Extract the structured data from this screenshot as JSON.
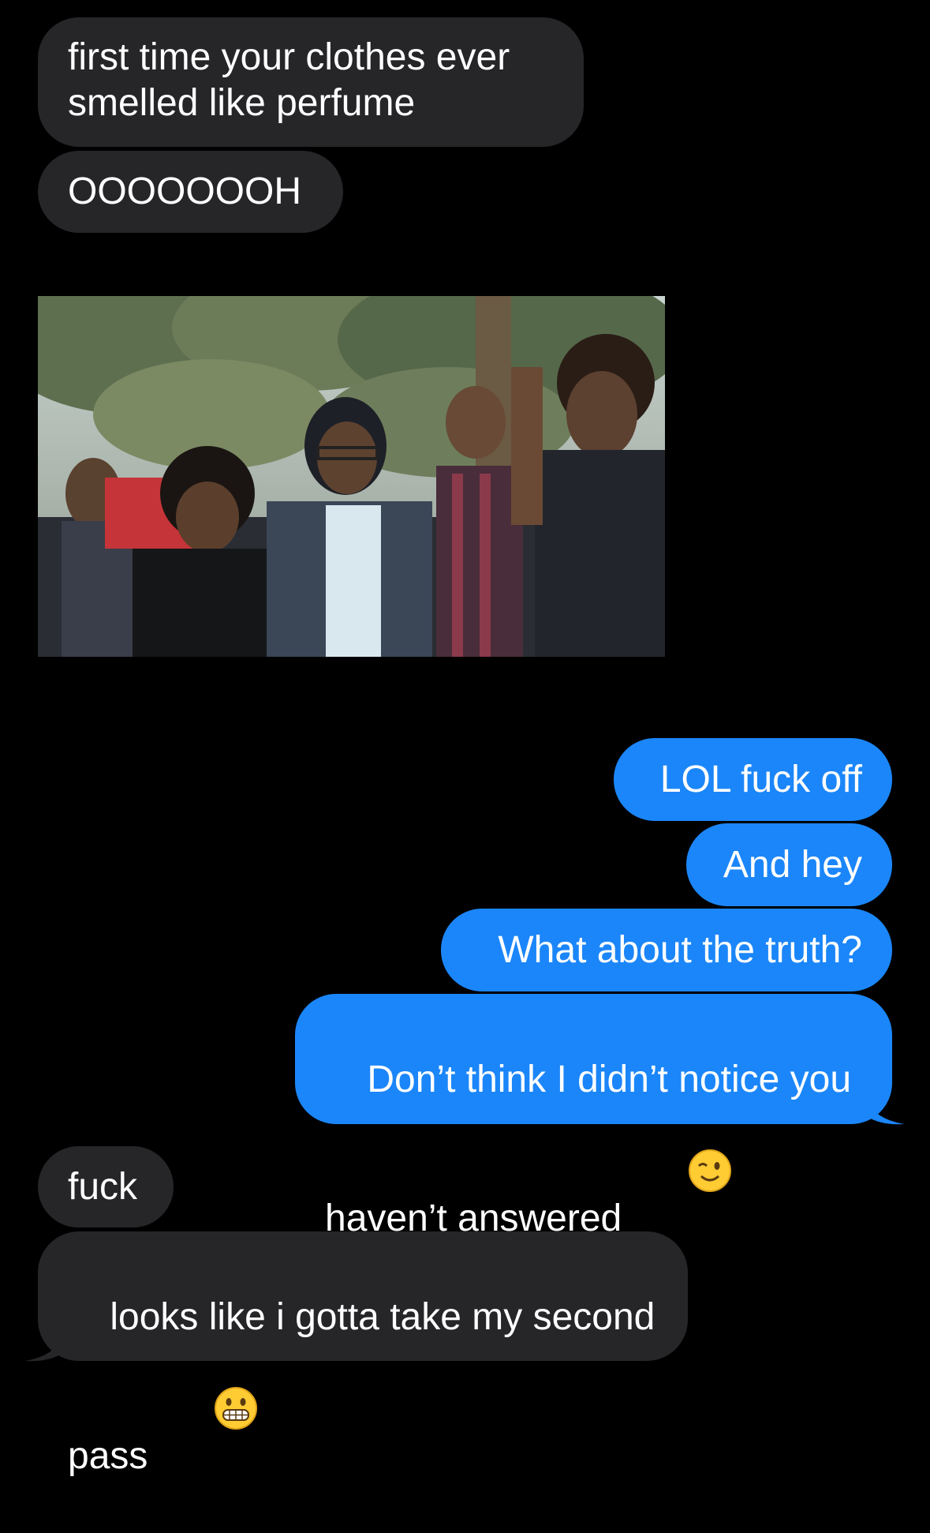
{
  "messages": [
    {
      "id": "m1",
      "direction": "incoming",
      "text": "first time your clothes ever\nsmelled like perfume"
    },
    {
      "id": "m2",
      "direction": "incoming",
      "text": "OOOOOOOH"
    },
    {
      "id": "m3",
      "direction": "incoming",
      "type": "image",
      "alt": "group of people shouting reaction gif"
    },
    {
      "id": "m4",
      "direction": "outgoing",
      "text": "LOL fuck off"
    },
    {
      "id": "m5",
      "direction": "outgoing",
      "text": "And hey"
    },
    {
      "id": "m6",
      "direction": "outgoing",
      "text": "What about the truth?"
    },
    {
      "id": "m7",
      "direction": "outgoing",
      "text": "Don’t think I didn’t notice you\nhaven’t answered",
      "emoji": "winking-face"
    },
    {
      "id": "m8",
      "direction": "incoming",
      "text": "fuck"
    },
    {
      "id": "m9",
      "direction": "incoming",
      "text": "looks like i gotta take my second\npass",
      "emoji": "grimacing-face"
    }
  ],
  "colors": {
    "background": "#000000",
    "incoming_bubble": "#262629",
    "outgoing_bubble": "#1b86f9",
    "text": "#ffffff"
  }
}
